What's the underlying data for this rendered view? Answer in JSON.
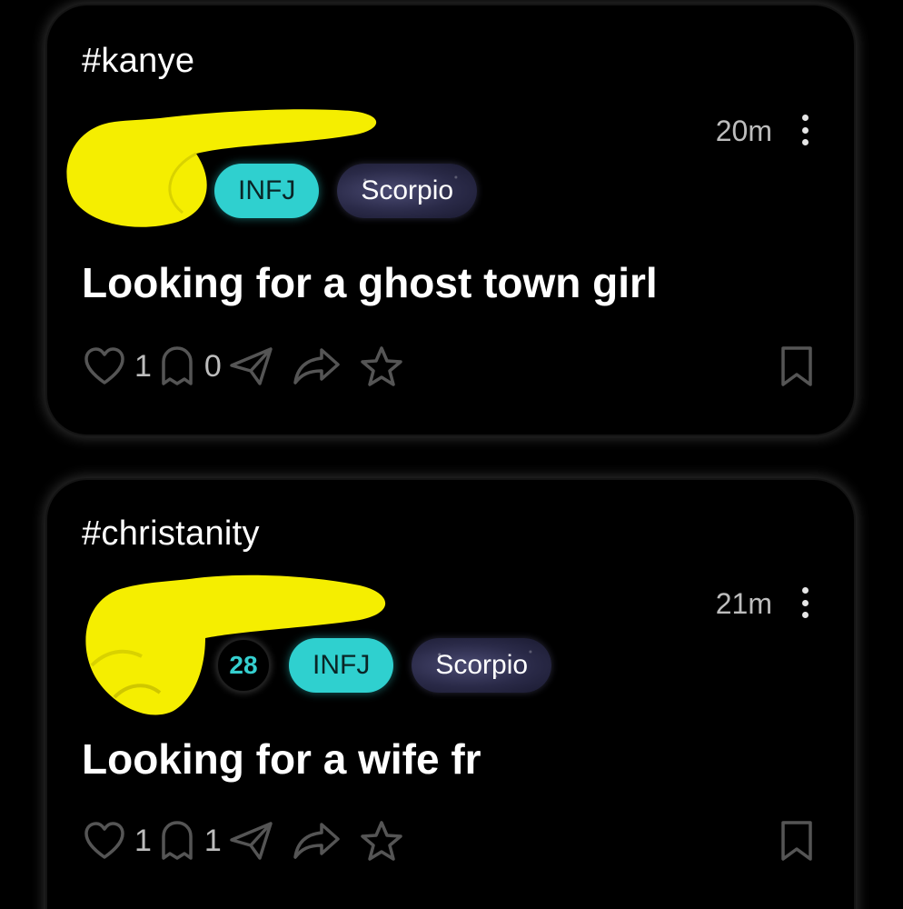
{
  "posts": [
    {
      "hashtag": "#kanye",
      "time": "20m",
      "age": null,
      "mbti": "INFJ",
      "zodiac": "Scorpio",
      "title": "Looking for a ghost town girl",
      "likes": "1",
      "comments": "0"
    },
    {
      "hashtag": "#christanity",
      "time": "21m",
      "age": "28",
      "mbti": "INFJ",
      "zodiac": "Scorpio",
      "title": "Looking for a wife fr",
      "likes": "1",
      "comments": "1"
    }
  ],
  "icons": {
    "like": "heart-icon",
    "comment": "ghost-icon",
    "send": "paper-plane-icon",
    "share": "share-arrow-icon",
    "favorite": "star-icon",
    "save": "bookmark-icon",
    "more": "more-vertical-icon"
  },
  "colors": {
    "background": "#000000",
    "mbti_pill": "#2fd0cf",
    "age_text": "#35cfcf",
    "redaction": "#f5ee00",
    "muted_text": "#bdbdbd"
  }
}
